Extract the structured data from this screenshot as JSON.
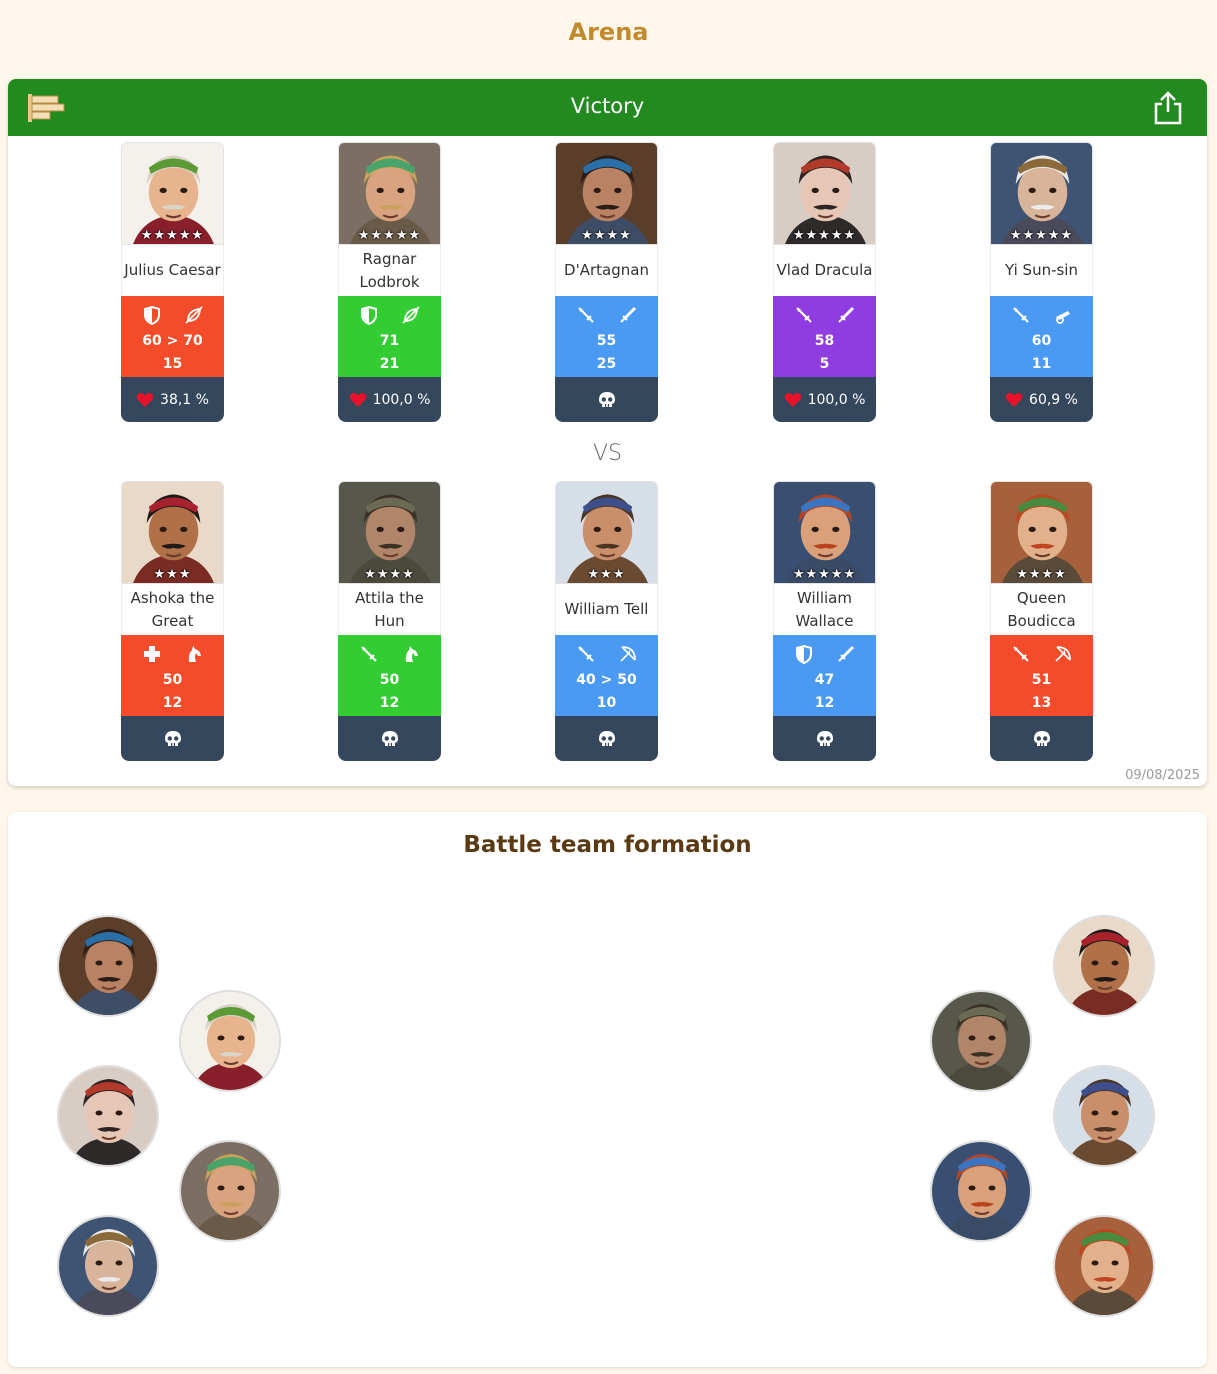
{
  "page": {
    "title": "Arena"
  },
  "battle": {
    "result": "Victory",
    "vs_label": "VS",
    "date": "09/08/2025",
    "attackers": [
      {
        "name": "Julius Caesar",
        "stars": "★★★★★",
        "color": "#f44c2a",
        "icons": [
          "shield-icon",
          "slashed-leaf-icon"
        ],
        "stat1": "60 > 70",
        "stat2": "15",
        "health": "38,1 %",
        "alive": true
      },
      {
        "name": "Ragnar Lodbrok",
        "stars": "★★★★★",
        "color": "#33cc33",
        "icons": [
          "shield-icon",
          "slashed-leaf-icon"
        ],
        "stat1": "71",
        "stat2": "21",
        "health": "100,0 %",
        "alive": true
      },
      {
        "name": "D'Artagnan",
        "stars": "★★★★",
        "color": "#4a9af4",
        "icons": [
          "crossed-swords-icon",
          "sword-icon"
        ],
        "stat1": "55",
        "stat2": "25",
        "health": "",
        "alive": false
      },
      {
        "name": "Vlad Dracula",
        "stars": "★★★★★",
        "color": "#8f3de0",
        "icons": [
          "crossed-swords-icon",
          "sword-icon"
        ],
        "stat1": "58",
        "stat2": "5",
        "health": "100,0 %",
        "alive": true
      },
      {
        "name": "Yi Sun-sin",
        "stars": "★★★★★",
        "color": "#4a9af4",
        "icons": [
          "crossed-swords-icon",
          "cannon-icon"
        ],
        "stat1": "60",
        "stat2": "11",
        "health": "60,9 %",
        "alive": true
      }
    ],
    "defenders": [
      {
        "name": "Ashoka the Great",
        "stars": "★★★",
        "color": "#f44c2a",
        "icons": [
          "medical-cross-icon",
          "horse-icon"
        ],
        "stat1": "50",
        "stat2": "12",
        "alive": false
      },
      {
        "name": "Attila the Hun",
        "stars": "★★★★",
        "color": "#33cc33",
        "icons": [
          "crossed-swords-icon",
          "horse-icon"
        ],
        "stat1": "50",
        "stat2": "12",
        "alive": false
      },
      {
        "name": "William Tell",
        "stars": "★★★",
        "color": "#4a9af4",
        "icons": [
          "crossed-swords-icon",
          "bow-icon"
        ],
        "stat1": "40 > 50",
        "stat2": "10",
        "alive": false
      },
      {
        "name": "William Wallace",
        "stars": "★★★★★",
        "color": "#4a9af4",
        "icons": [
          "shield-icon",
          "sword-icon"
        ],
        "stat1": "47",
        "stat2": "12",
        "alive": false
      },
      {
        "name": "Queen Boudicca",
        "stars": "★★★★",
        "color": "#f44c2a",
        "icons": [
          "crossed-swords-icon",
          "bow-icon"
        ],
        "stat1": "51",
        "stat2": "13",
        "alive": false
      }
    ]
  },
  "formation": {
    "title": "Battle team formation",
    "left_team": [
      "D'Artagnan",
      "Julius Caesar",
      "Vlad Dracula",
      "Ragnar Lodbrok",
      "Yi Sun-sin"
    ],
    "right_team": [
      "Ashoka the Great",
      "Attila the Hun",
      "William Tell",
      "William Wallace",
      "Queen Boudicca"
    ]
  }
}
